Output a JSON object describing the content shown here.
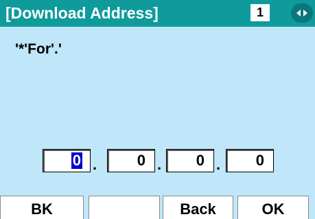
{
  "title_bar": {
    "title": "[Download Address]",
    "page_number": "1"
  },
  "prompt": "'*'For'.'",
  "address": {
    "octets": [
      "0",
      "0",
      "0",
      "0"
    ],
    "separator": "."
  },
  "softkeys": {
    "bk": "BK",
    "blank": "",
    "back": "Back",
    "ok": "OK"
  },
  "colors": {
    "title_bar": "#0f9a9c",
    "background": "#bfe6f9",
    "cursor": "#0000cc"
  },
  "icons": {
    "page_nav": "left-right-arrows-icon"
  }
}
